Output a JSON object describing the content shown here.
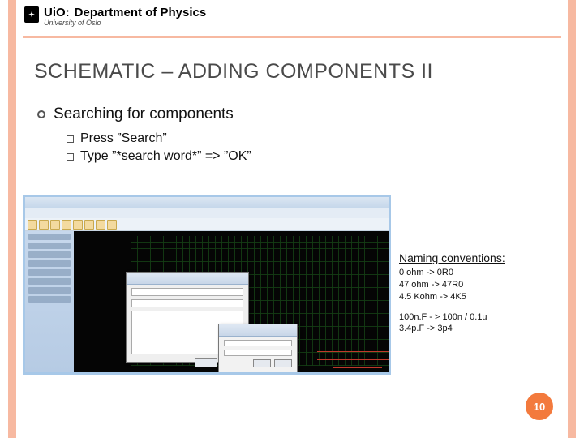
{
  "header": {
    "brand": "UiO",
    "separator": ":",
    "department": "Department of Physics",
    "subbrand": "University of Oslo"
  },
  "title": {
    "full": "SCHEMATIC – ADDING COMPONENTS II"
  },
  "bullet": {
    "main": "Searching for components",
    "sub1": "Press ”Search”",
    "sub2": "Type ”*search word*” => ”OK”"
  },
  "notes": {
    "heading": "Naming conventions:",
    "group1_line1": "0 ohm -> 0R0",
    "group1_line2": "47 ohm -> 47R0",
    "group1_line3": "4.5 Kohm -> 4K5",
    "group2_line1": "100n.F - > 100n / 0.1u",
    "group2_line2": "3.4p.F  -> 3p4"
  },
  "page": {
    "number": "10"
  }
}
